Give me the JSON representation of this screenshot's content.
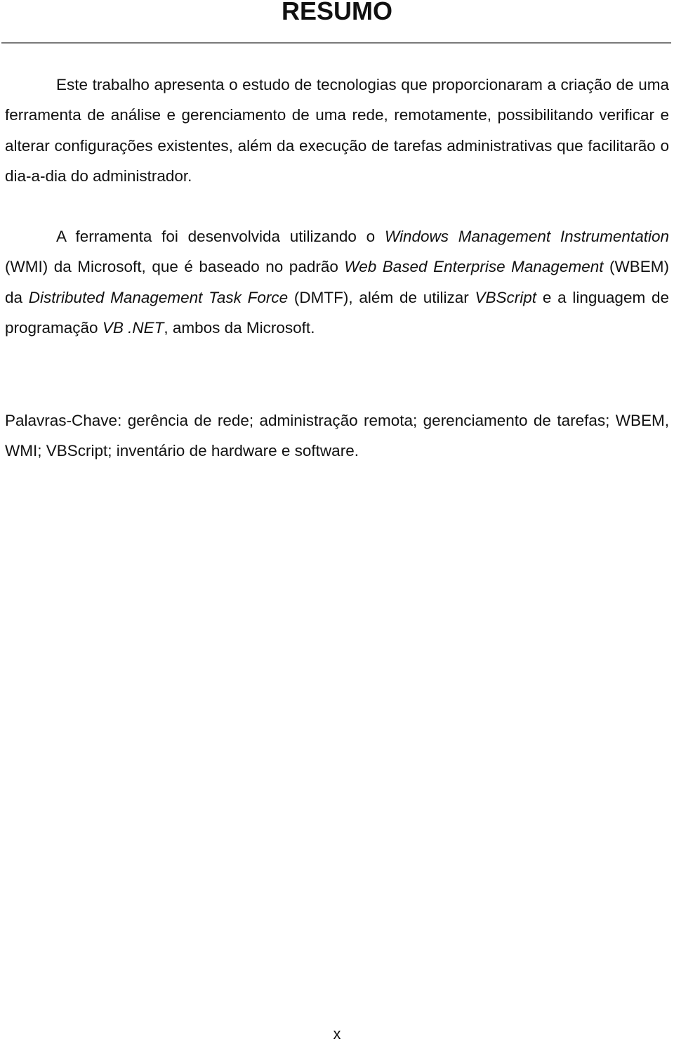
{
  "document": {
    "title": "RESUMO",
    "paragraph1": "Este trabalho apresenta o estudo de tecnologias que proporcionaram a criação de uma ferramenta de análise e gerenciamento de uma rede, remotamente, possibilitando verificar e alterar configurações existentes, além da execução de tarefas administrativas que facilitarão o dia-a-dia do administrador.",
    "paragraph2": {
      "segments": [
        {
          "text": "A ferramenta foi desenvolvida utilizando o ",
          "italic": false
        },
        {
          "text": "Windows Management Instrumentation",
          "italic": true
        },
        {
          "text": " (WMI) da Microsoft, que é baseado no padrão ",
          "italic": false
        },
        {
          "text": "Web Based Enterprise Management",
          "italic": true
        },
        {
          "text": " (WBEM) da ",
          "italic": false
        },
        {
          "text": "Distributed Management Task Force",
          "italic": true
        },
        {
          "text": " (DMTF), além de utilizar ",
          "italic": false
        },
        {
          "text": "VBScript",
          "italic": true
        },
        {
          "text": " e a linguagem de programação ",
          "italic": false
        },
        {
          "text": "VB .NET",
          "italic": true
        },
        {
          "text": ", ambos da Microsoft.",
          "italic": false
        }
      ]
    },
    "keywords": {
      "label": "Palavras-Chave:",
      "text": " gerência de rede; administração remota; gerenciamento de tarefas; WBEM, WMI; VBScript; inventário de hardware e software."
    },
    "page_number": "x"
  }
}
